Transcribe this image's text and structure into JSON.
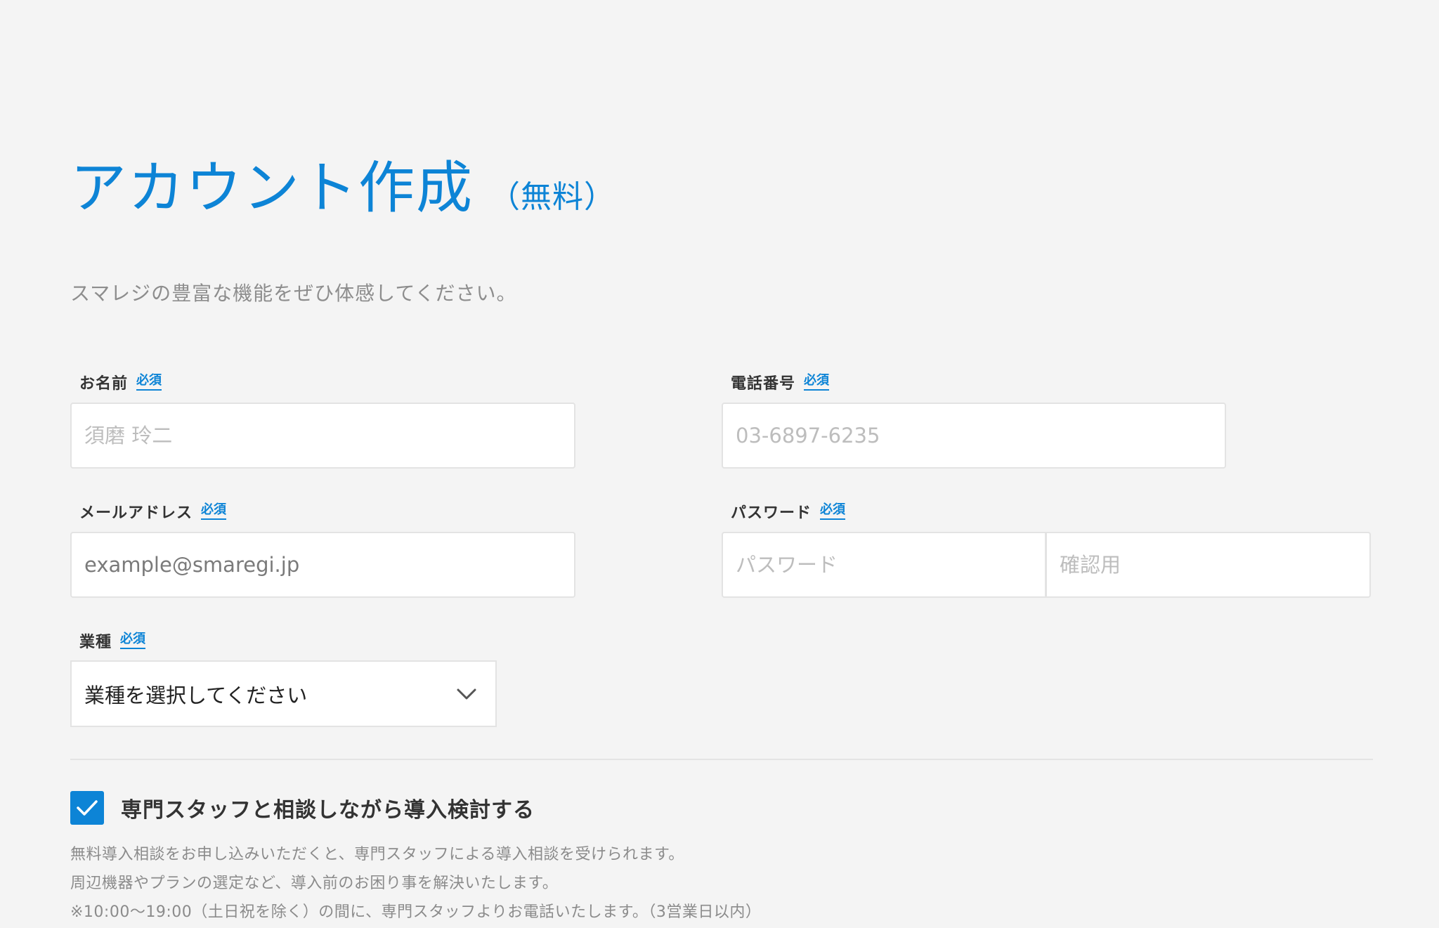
{
  "header": {
    "title": "アカウント作成",
    "title_suffix": "（無料）",
    "subtitle": "スマレジの豊富な機能をぜひ体感してください。"
  },
  "form": {
    "required_label": "必須",
    "name": {
      "label": "お名前",
      "placeholder": "須磨 玲二"
    },
    "phone": {
      "label": "電話番号",
      "placeholder": "03-6897-6235"
    },
    "email": {
      "label": "メールアドレス",
      "value": "example@smaregi.jp"
    },
    "password": {
      "label": "パスワード",
      "placeholder": "パスワード",
      "confirm_placeholder": "確認用"
    },
    "industry": {
      "label": "業種",
      "selected": "業種を選択してください",
      "icon": "chevron-down-icon"
    }
  },
  "consultation": {
    "checked": true,
    "label": "専門スタッフと相談しながら導入検討する",
    "notes": [
      "無料導入相談をお申し込みいただくと、専門スタッフによる導入相談を受けられます。",
      "周辺機器やプランの選定など、導入前のお困り事を解決いたします。",
      "※10:00〜19:00（土日祝を除く）の間に、専門スタッフよりお電話いたします。（3営業日以内）"
    ]
  },
  "colors": {
    "accent": "#0d84d6",
    "background": "#f4f4f4",
    "input_background": "#ffffff",
    "muted_text": "#8b8b8b"
  }
}
